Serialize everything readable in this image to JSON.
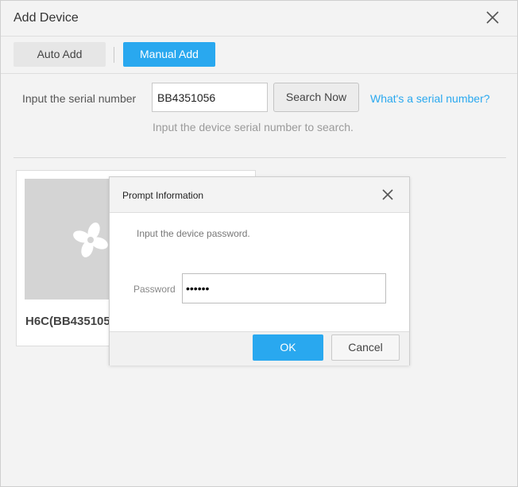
{
  "window": {
    "title": "Add Device"
  },
  "tabs": {
    "auto_label": "Auto Add",
    "manual_label": "Manual Add",
    "active": "Manual Add"
  },
  "serial": {
    "label": "Input the serial number",
    "value": "BB4351056",
    "search_label": "Search Now",
    "help_link": "What's a serial number?",
    "hint": "Input the device serial number to search."
  },
  "device_card": {
    "name": "H6C(BB435105",
    "logo_icon": "fan-logo-icon"
  },
  "dialog": {
    "title": "Prompt Information",
    "message": "Input the device password.",
    "password_label": "Password",
    "password_value": "123456",
    "ok_label": "OK",
    "cancel_label": "Cancel"
  },
  "colors": {
    "accent": "#29a8ef",
    "background": "#f3f3f3"
  }
}
